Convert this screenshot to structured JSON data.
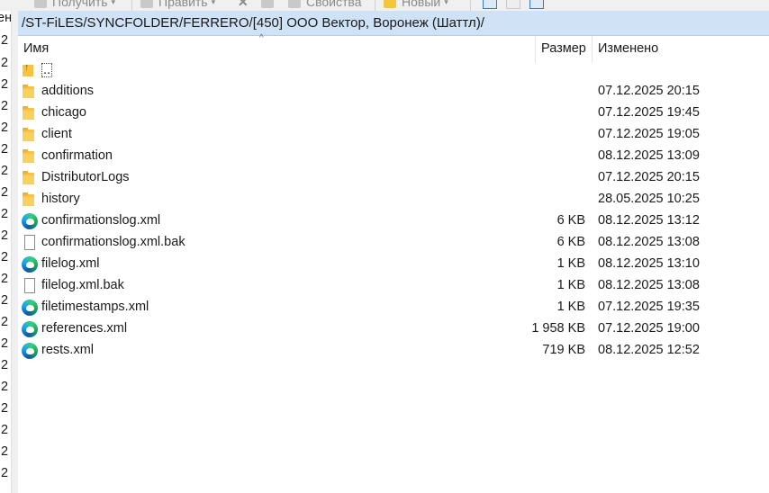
{
  "toolbar": {
    "get_label": "Получить",
    "edit_label": "Править",
    "properties_label": "Свойства",
    "new_label": "Новый"
  },
  "left_pane": {
    "fragments": [
      "ен",
      ".2",
      ".2",
      ".2",
      ".2",
      ".2",
      ".2",
      ".2",
      ".2",
      ".2",
      ".2",
      ".2",
      ".2",
      ".2",
      ".2",
      ".2",
      ".2",
      ".2",
      ".2",
      ".2",
      ".2",
      ".2"
    ]
  },
  "path": "/ST-FiLES/SYNCFOLDER/FERRERO/[450] ООО Вектор, Воронеж (Шаттл)/",
  "columns": {
    "name": "Имя",
    "size": "Размер",
    "modified": "Изменено"
  },
  "parent_dir": "..",
  "files": [
    {
      "name": "additions",
      "type": "folder",
      "size": "",
      "modified": "07.12.2025 20:15"
    },
    {
      "name": "chicago",
      "type": "folder",
      "size": "",
      "modified": "07.12.2025 19:45"
    },
    {
      "name": "client",
      "type": "folder",
      "size": "",
      "modified": "07.12.2025 19:05"
    },
    {
      "name": "confirmation",
      "type": "folder",
      "size": "",
      "modified": "08.12.2025 13:09"
    },
    {
      "name": "DistributorLogs",
      "type": "folder",
      "size": "",
      "modified": "07.12.2025 20:15"
    },
    {
      "name": "history",
      "type": "folder",
      "size": "",
      "modified": "28.05.2025 10:25"
    },
    {
      "name": "confirmationslog.xml",
      "type": "xml",
      "size": "6 KB",
      "modified": "08.12.2025 13:12"
    },
    {
      "name": "confirmationslog.xml.bak",
      "type": "file",
      "size": "6 KB",
      "modified": "08.12.2025 13:08"
    },
    {
      "name": "filelog.xml",
      "type": "xml",
      "size": "1 KB",
      "modified": "08.12.2025 13:10"
    },
    {
      "name": "filelog.xml.bak",
      "type": "file",
      "size": "1 KB",
      "modified": "08.12.2025 13:08"
    },
    {
      "name": "filetimestamps.xml",
      "type": "xml",
      "size": "1 KB",
      "modified": "07.12.2025 19:35"
    },
    {
      "name": "references.xml",
      "type": "xml",
      "size": "1 958 KB",
      "modified": "07.12.2025 19:00"
    },
    {
      "name": "rests.xml",
      "type": "xml",
      "size": "719 KB",
      "modified": "08.12.2025 12:52"
    }
  ]
}
